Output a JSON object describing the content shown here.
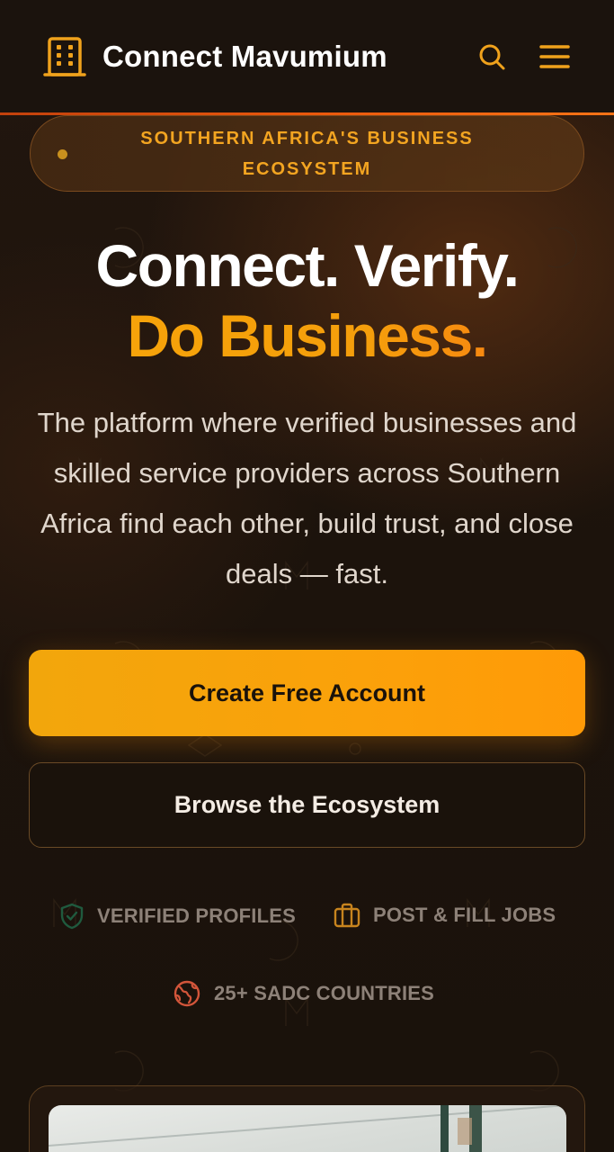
{
  "header": {
    "brand": "Connect Mavumium",
    "logo_icon": "building-icon",
    "search_icon": "search-icon",
    "menu_icon": "hamburger-menu-icon"
  },
  "hero": {
    "badge": "SOUTHERN AFRICA'S BUSINESS ECOSYSTEM",
    "headline_line1": "Connect. Verify.",
    "headline_line2": "Do Business.",
    "subtitle": "The platform where verified businesses and skilled service providers across Southern Africa find each other, build trust, and close deals — fast.",
    "primary_cta": "Create Free Account",
    "secondary_cta": "Browse the Ecosystem"
  },
  "features": [
    {
      "label": "VERIFIED PROFILES",
      "icon": "shield-check-icon",
      "color": "#1f5a3e"
    },
    {
      "label": "POST & FILL JOBS",
      "icon": "briefcase-icon",
      "color": "#c8841e"
    },
    {
      "label": "25+ SADC COUNTRIES",
      "icon": "globe-icon",
      "color": "#d2553a"
    }
  ],
  "colors": {
    "accent": "#f59e0b",
    "accent_orange": "#f97316",
    "background": "#1a120c",
    "header_line": "#ea580c"
  }
}
